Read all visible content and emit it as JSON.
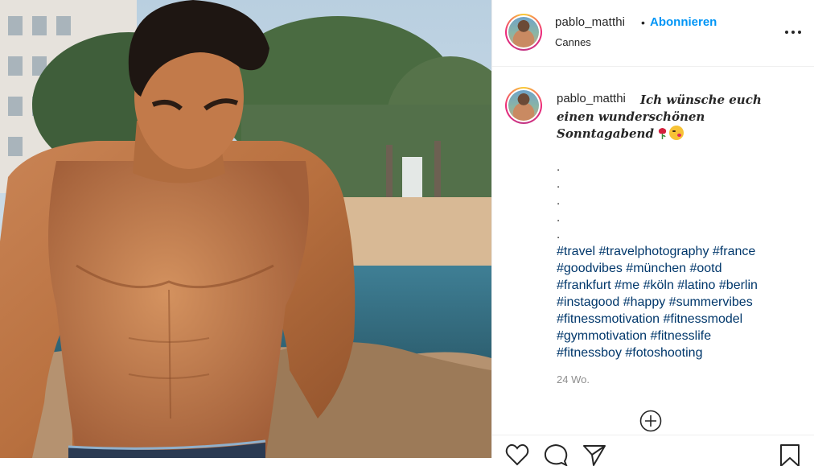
{
  "post": {
    "photo_alt": "",
    "author": {
      "username": "pablo_matthi",
      "follow_label": "Abonnieren",
      "separator": "•",
      "location": "Cannes",
      "more_icon": "more-horizontal-icon"
    },
    "caption": {
      "username": "pablo_matthi",
      "text": "Ich wünsche euch einen wunderschönen Sonntagabend",
      "emojis": [
        "rose-emoji",
        "kiss-emoji"
      ],
      "dots": [
        ".",
        ".",
        ".",
        ".",
        "."
      ],
      "hashtag_lines": [
        "#travel #travelphotography #france",
        "#goodvibes #münchen #ootd",
        "#frankfurt #me #köln #latino #berlin",
        "#instagood #happy #summervibes",
        "#fitnessmotivation #fitnessmodel",
        "#gymmotivation #fitnesslife",
        "#fitnessboy #fotoshooting"
      ],
      "timestamp": "24 Wo."
    },
    "actions": {
      "icons": [
        "heart-icon",
        "comment-icon",
        "share-icon",
        "bookmark-icon"
      ],
      "add_comment_icon": "plus-circle-icon"
    },
    "colors": {
      "link_blue": "#0095f6",
      "hashtag": "#00376b",
      "muted": "#8e8e8e",
      "text": "#262626"
    }
  }
}
